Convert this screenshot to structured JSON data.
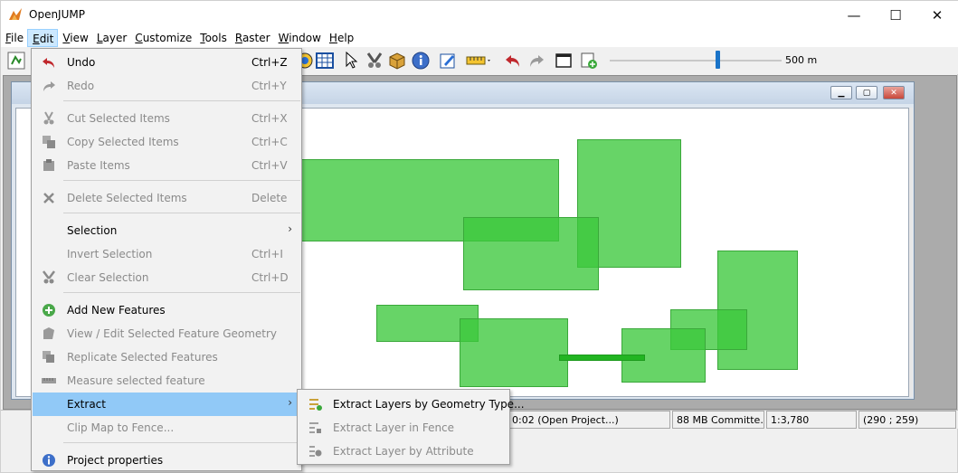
{
  "window": {
    "title": "OpenJUMP"
  },
  "window_controls": {
    "minimize": "—",
    "maximize": "☐",
    "close": "✕"
  },
  "menubar": [
    {
      "label": "File",
      "u": "F",
      "rest": "ile"
    },
    {
      "label": "Edit",
      "u": "E",
      "rest": "dit"
    },
    {
      "label": "View",
      "u": "V",
      "rest": "iew"
    },
    {
      "label": "Layer",
      "u": "L",
      "rest": "ayer"
    },
    {
      "label": "Customize",
      "u": "C",
      "rest": "ustomize"
    },
    {
      "label": "Tools",
      "u": "T",
      "rest": "ools"
    },
    {
      "label": "Raster",
      "u": "R",
      "rest": "aster"
    },
    {
      "label": "Window",
      "u": "W",
      "rest": "indow"
    },
    {
      "label": "Help",
      "u": "H",
      "rest": "elp"
    }
  ],
  "toolbar": {
    "scale_label": "500 m"
  },
  "edit_menu": {
    "items": [
      {
        "label": "Undo",
        "shortcut": "Ctrl+Z",
        "enabled": true,
        "icon": "undo-icon"
      },
      {
        "label": "Redo",
        "shortcut": "Ctrl+Y",
        "enabled": false,
        "icon": "redo-icon"
      },
      {
        "label": "Cut Selected Items",
        "shortcut": "Ctrl+X",
        "enabled": false,
        "icon": "cut-icon"
      },
      {
        "label": "Copy Selected Items",
        "shortcut": "Ctrl+C",
        "enabled": false,
        "icon": "copy-icon"
      },
      {
        "label": "Paste Items",
        "shortcut": "Ctrl+V",
        "enabled": false,
        "icon": "paste-icon"
      },
      {
        "label": "Delete Selected Items",
        "shortcut": "Delete",
        "enabled": false,
        "icon": "delete-icon"
      },
      {
        "label": "Selection",
        "shortcut": "",
        "enabled": true,
        "icon": "",
        "submenu": true
      },
      {
        "label": "Invert Selection",
        "shortcut": "Ctrl+I",
        "enabled": false,
        "icon": ""
      },
      {
        "label": "Clear Selection",
        "shortcut": "Ctrl+D",
        "enabled": false,
        "icon": "clear-selection-icon"
      },
      {
        "label": "Add New Features",
        "shortcut": "",
        "enabled": true,
        "icon": "add-features-icon"
      },
      {
        "label": "View / Edit Selected Feature Geometry",
        "shortcut": "",
        "enabled": false,
        "icon": "edit-geometry-icon"
      },
      {
        "label": "Replicate Selected Features",
        "shortcut": "",
        "enabled": false,
        "icon": "replicate-icon"
      },
      {
        "label": "Measure selected feature",
        "shortcut": "",
        "enabled": false,
        "icon": "measure-icon"
      },
      {
        "label": "Extract",
        "shortcut": "",
        "enabled": true,
        "icon": "",
        "submenu": true,
        "highlighted": true
      },
      {
        "label": "Clip Map to Fence...",
        "shortcut": "",
        "enabled": false,
        "icon": ""
      },
      {
        "label": "Project properties",
        "shortcut": "",
        "enabled": true,
        "icon": "info-icon"
      }
    ]
  },
  "extract_submenu": {
    "items": [
      {
        "label": "Extract Layers by Geometry Type...",
        "enabled": true,
        "icon": "extract-geometry-icon"
      },
      {
        "label": "Extract Layer in Fence",
        "enabled": false,
        "icon": "extract-fence-icon"
      },
      {
        "label": "Extract Layer by Attribute",
        "enabled": false,
        "icon": "extract-attribute-icon"
      }
    ]
  },
  "statusbar": {
    "time": "0:02 (Open Project...)",
    "memory": "88 MB Committe...",
    "scale": "1:3,780",
    "coords": "(290 ; 259)"
  },
  "colors": {
    "feature_fill": "#3cc83c",
    "highlight": "#91c9f7"
  }
}
